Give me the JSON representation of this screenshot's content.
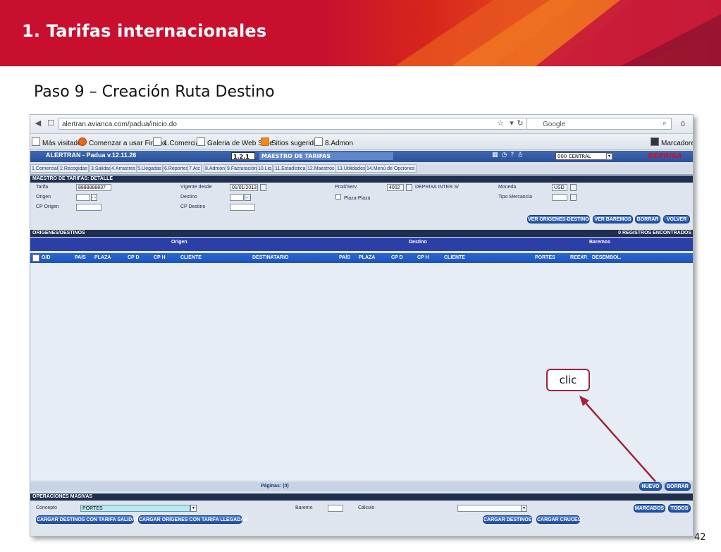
{
  "slide": {
    "title": "1. Tarifas internacionales",
    "step": "Paso 9 – Creación Ruta Destino",
    "page_number": "42",
    "callout": "clic"
  },
  "browser": {
    "url": "alertran.avianca.com/padua/inicio.do",
    "search_placeholder": "Google",
    "bookmarks": [
      "Más visitados",
      "Comenzar a usar Firefox",
      "1.Comercial",
      "Galeria de Web Slice",
      "Sitios sugeridos",
      "8.Admon"
    ],
    "bookmarks_menu": "Marcadores"
  },
  "app": {
    "title": "ALERTRAN - Padua  v.12.11.26",
    "version_box": "1.2.1",
    "section": "MAESTRO DE TARIFAS",
    "central": "000 CENTRAL",
    "brand": "DEPRISA",
    "menu": [
      "1.Comercial",
      "2.Recogidas",
      "3.Salidas",
      "4.Arrastres",
      "5.Llegadas",
      "6.Reportes",
      "7.Atc",
      "8.Admon",
      "9.Facturación",
      "10.Liq",
      "11.Estadísticas",
      "12.Maestros",
      "13.Utilidades",
      "14.Menú de Opciones"
    ]
  },
  "detail": {
    "header": "MAESTRO DE TARIFAS: DETALLE",
    "tarifa_label": "Tarifa",
    "tarifa_value": "8888888837",
    "origen_label": "Origen",
    "cp_origen_label": "CP Origen",
    "vigente_label": "Vigente desde",
    "vigente_value": "01/01/2013",
    "destino_label": "Destino",
    "cp_destino_label": "CP Destino",
    "prod_label": "Prod/Serv",
    "prod_code": "4002",
    "prod_name": "DEPRISA INTER S/",
    "plaza_label": "Plaza-Plaza",
    "moneda_label": "Moneda",
    "moneda_value": "USD",
    "tipo_label": "Tipo Mercancía",
    "buttons": [
      "VER ORIGENES-DESTINOS",
      "VER BAREMOS",
      "BORRAR",
      "VOLVER"
    ]
  },
  "grid": {
    "header": "ORIGENES/DESTINOS",
    "count": "0 REGISTROS ENCONTRADOS",
    "groups": [
      "Origen",
      "Destino",
      "Baremos"
    ],
    "columns": [
      "O/D",
      "PAÍS",
      "PLAZA",
      "CP D",
      "CP H",
      "CLIENTE",
      "DESTINATARIO",
      "PAÍS",
      "PLAZA",
      "CP D",
      "CP H",
      "CLIENTE",
      "PORTES",
      "REEXP.",
      "DESEMBOL."
    ],
    "pages": "Páginas: (0)",
    "new_button": "NUEVO",
    "delete_button": "BORRAR"
  },
  "ops": {
    "header": "OPERACIONES MASIVAS",
    "concepto_label": "Concepto",
    "concepto_value": "PORTES",
    "baremo_label": "Baremo",
    "calculo_label": "Cálculo",
    "buttons": [
      "MARCADOS",
      "TODOS",
      "CARGAR DESTINOS CON TARIFA SALIDAS",
      "CARGAR ORÍGENES CON TARIFA LLEGADAS",
      "CARGAR DESTINOS",
      "CARGAR CRUCES"
    ]
  },
  "colors": {
    "brand_red": "#c8102e",
    "app_blue": "#2b3fa6",
    "callout_border": "#a0243a"
  }
}
